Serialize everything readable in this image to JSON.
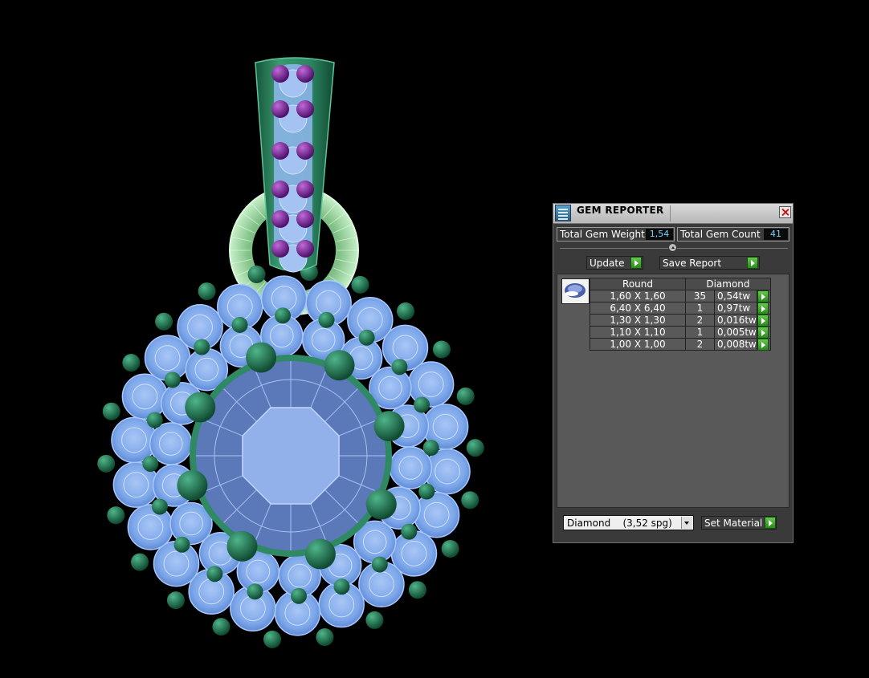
{
  "panel": {
    "title": "GEM REPORTER",
    "total_weight_label": "Total Gem Weight",
    "total_weight_value": "1,54",
    "total_count_label": "Total Gem Count",
    "total_count_value": "41",
    "update_label": "Update",
    "save_report_label": "Save Report",
    "table": {
      "col_shape": "Round",
      "col_material": "Diamond",
      "rows": [
        {
          "size": "1,60 X 1,60",
          "count": "35",
          "weight": "0,54tw"
        },
        {
          "size": "6,40 X 6,40",
          "count": "1",
          "weight": "0,97tw"
        },
        {
          "size": "1,30 X 1,30",
          "count": "2",
          "weight": "0,016tw"
        },
        {
          "size": "1,10 X 1,10",
          "count": "1",
          "weight": "0,005tw"
        },
        {
          "size": "1,00 X 1,00",
          "count": "2",
          "weight": "0,008tw"
        }
      ]
    },
    "material_select": "Diamond    (3,52 spg)",
    "set_material_label": "Set Material"
  },
  "colors": {
    "background": "#000000",
    "gem_blue": "#8fb6f0",
    "prong_green": "#1f7a55",
    "bail_green": "#2f8a63",
    "accent_gem_purple": "#8a2fa8",
    "go_button": "#3aa82a",
    "value_text": "#6fd6ff"
  },
  "icons": [
    "gem-reporter-icon",
    "close-icon",
    "divider-toggle-icon",
    "play-arrow-icon",
    "dropdown-arrow-icon",
    "gem-thumbnail-icon"
  ]
}
